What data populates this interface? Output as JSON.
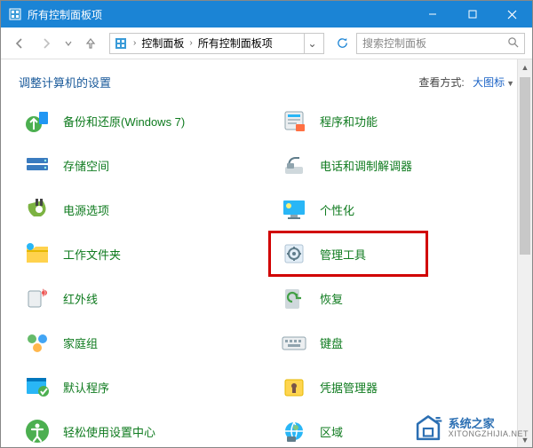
{
  "window": {
    "title": "所有控制面板项"
  },
  "nav": {
    "breadcrumb": {
      "root": "控制面板",
      "current": "所有控制面板项"
    },
    "search": {
      "placeholder": "搜索控制面板"
    }
  },
  "header": {
    "heading": "调整计算机的设置",
    "viewby_label": "查看方式:",
    "viewby_value": "大图标"
  },
  "items": {
    "left": [
      {
        "label": "备份和还原(Windows 7)",
        "icon": "backup"
      },
      {
        "label": "存储空间",
        "icon": "storage"
      },
      {
        "label": "电源选项",
        "icon": "power"
      },
      {
        "label": "工作文件夹",
        "icon": "workfolders"
      },
      {
        "label": "红外线",
        "icon": "infrared"
      },
      {
        "label": "家庭组",
        "icon": "homegroup"
      },
      {
        "label": "默认程序",
        "icon": "defaultprograms"
      },
      {
        "label": "轻松使用设置中心",
        "icon": "easeofaccess"
      }
    ],
    "right": [
      {
        "label": "程序和功能",
        "icon": "programs"
      },
      {
        "label": "电话和调制解调器",
        "icon": "phone"
      },
      {
        "label": "个性化",
        "icon": "personalize"
      },
      {
        "label": "管理工具",
        "icon": "admintools",
        "highlighted": true
      },
      {
        "label": "恢复",
        "icon": "recovery"
      },
      {
        "label": "键盘",
        "icon": "keyboard"
      },
      {
        "label": "凭据管理器",
        "icon": "credentials"
      },
      {
        "label": "区域",
        "icon": "region"
      }
    ]
  },
  "watermark": {
    "text": "系统之家",
    "sub": "XITONGZHIJIA.NET"
  }
}
